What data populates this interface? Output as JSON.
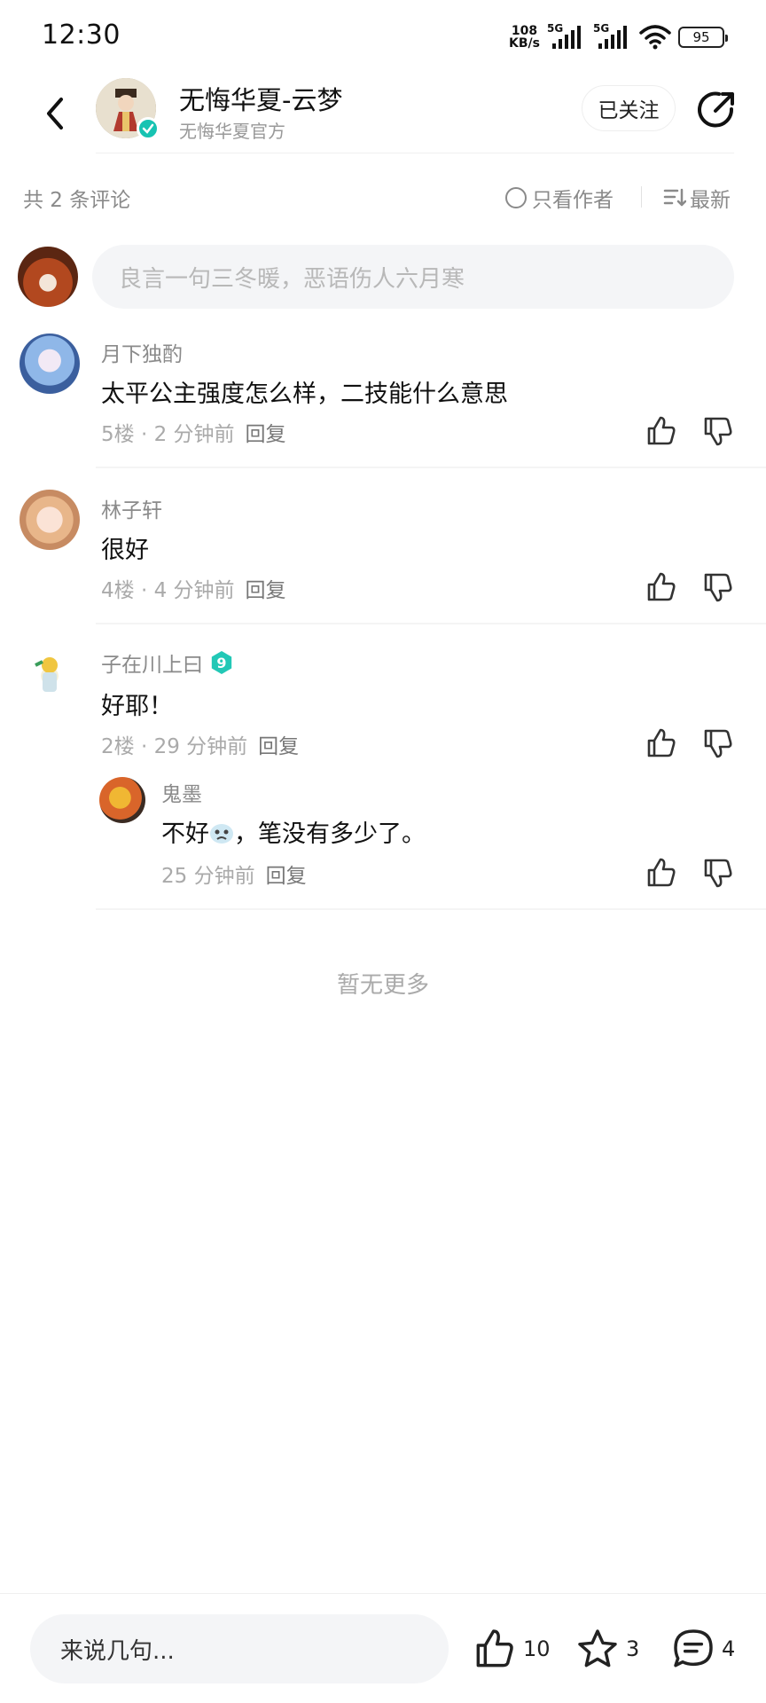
{
  "status_bar": {
    "time": "12:30",
    "net_speed_value": "108",
    "net_speed_unit": "KB/s",
    "signal_1": "5G",
    "signal_2": "5G",
    "battery": "95"
  },
  "header": {
    "name": "无悔华夏-云梦",
    "subtitle": "无悔华夏官方",
    "follow_label": "已关注"
  },
  "filter": {
    "count_label": "共 2 条评论",
    "author_only_label": "只看作者",
    "sort_label": "最新"
  },
  "comment_input": {
    "placeholder": "良言一句三冬暖，恶语伤人六月寒"
  },
  "comments": [
    {
      "user": "月下独酌",
      "text": "太平公主强度怎么样，二技能什么意思",
      "meta": "5楼 · 2 分钟前",
      "reply_label": "回复"
    },
    {
      "user": "林子轩",
      "text": "很好",
      "meta": "4楼 · 4 分钟前",
      "reply_label": "回复"
    },
    {
      "user": "子在川上曰",
      "level": "9",
      "text": "好耶！",
      "meta": "2楼 · 29 分钟前",
      "reply_label": "回复",
      "replies": [
        {
          "user": "鬼墨",
          "text_before": "不好",
          "text_after": "，笔没有多少了。",
          "meta": "25 分钟前",
          "reply_label": "回复"
        }
      ]
    }
  ],
  "no_more_label": "暂无更多",
  "bottom_bar": {
    "input_placeholder": "来说几句...",
    "like_count": "10",
    "star_count": "3",
    "comment_count": "4"
  },
  "colors": {
    "accent_teal": "#17c3b2",
    "muted_text": "#8a8a8a",
    "input_bg": "#f4f5f7"
  },
  "icons": [
    "back-icon",
    "share-icon",
    "thumb-up-icon",
    "thumb-down-icon",
    "star-icon",
    "comment-icon",
    "sort-icon",
    "verified-icon"
  ]
}
